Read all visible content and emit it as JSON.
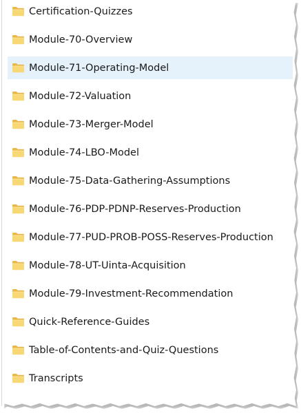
{
  "folder_list": {
    "folders": [
      {
        "label": "Certification-Quizzes",
        "icon": "folder-icon",
        "selected": false
      },
      {
        "label": "Module-70-Overview",
        "icon": "folder-icon",
        "selected": false
      },
      {
        "label": "Module-71-Operating-Model",
        "icon": "folder-icon",
        "selected": true
      },
      {
        "label": "Module-72-Valuation",
        "icon": "folder-icon",
        "selected": false
      },
      {
        "label": "Module-73-Merger-Model",
        "icon": "folder-icon",
        "selected": false
      },
      {
        "label": "Module-74-LBO-Model",
        "icon": "folder-icon",
        "selected": false
      },
      {
        "label": "Module-75-Data-Gathering-Assumptions",
        "icon": "folder-icon",
        "selected": false
      },
      {
        "label": "Module-76-PDP-PDNP-Reserves-Production",
        "icon": "folder-icon",
        "selected": false
      },
      {
        "label": "Module-77-PUD-PROB-POSS-Reserves-Production",
        "icon": "folder-icon",
        "selected": false
      },
      {
        "label": "Module-78-UT-Uinta-Acquisition",
        "icon": "folder-icon",
        "selected": false
      },
      {
        "label": "Module-79-Investment-Recommendation",
        "icon": "folder-icon",
        "selected": false
      },
      {
        "label": "Quick-Reference-Guides",
        "icon": "folder-icon",
        "selected": false
      },
      {
        "label": "Table-of-Contents-and-Quiz-Questions",
        "icon": "folder-icon",
        "selected": false
      },
      {
        "label": "Transcripts",
        "icon": "folder-icon",
        "selected": false
      }
    ]
  },
  "colors": {
    "selection_background": "#e5f1fb",
    "folder_body": "#f8d775",
    "folder_tab": "#e8b84a",
    "text": "#1a1a1a"
  }
}
